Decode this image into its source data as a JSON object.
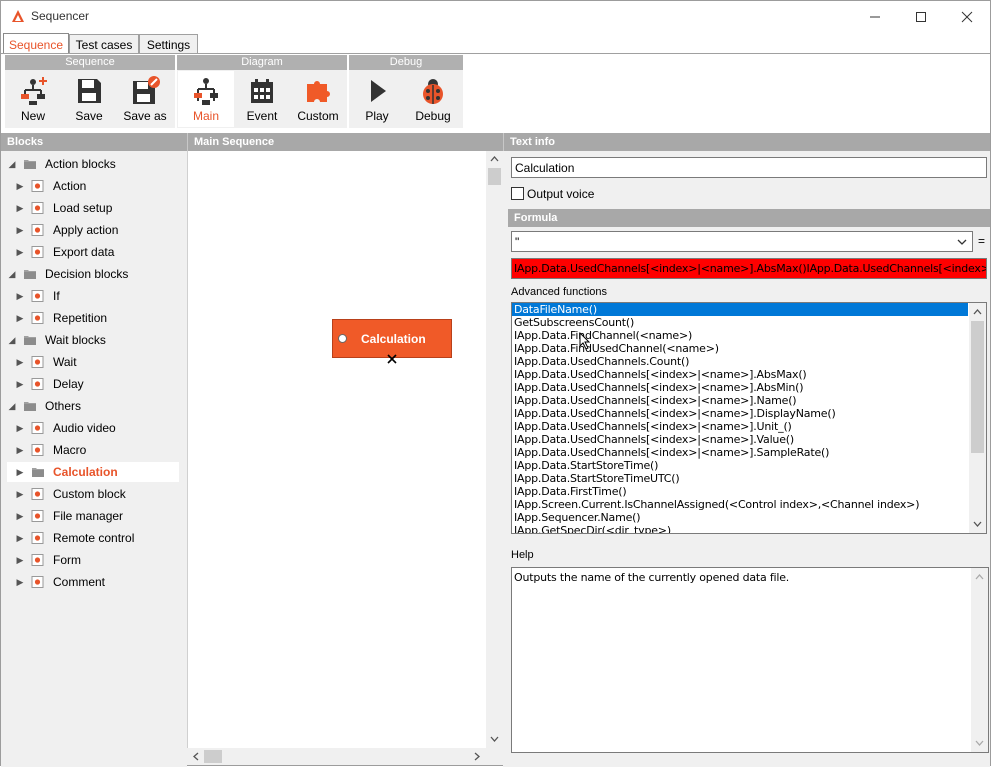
{
  "window": {
    "title": "Sequencer",
    "accent": "#e8542a"
  },
  "tabs": [
    {
      "label": "Sequence"
    },
    {
      "label": "Test cases"
    },
    {
      "label": "Settings"
    }
  ],
  "ribbon": {
    "groups": [
      {
        "title": "Sequence",
        "buttons": [
          {
            "label": "New",
            "icon": "new-block-icon"
          },
          {
            "label": "Save",
            "icon": "floppy-icon"
          },
          {
            "label": "Save as",
            "icon": "floppy-edit-icon"
          }
        ]
      },
      {
        "title": "Diagram",
        "buttons": [
          {
            "label": "Main",
            "icon": "diagram-icon"
          },
          {
            "label": "Event",
            "icon": "calendar-icon"
          },
          {
            "label": "Custom",
            "icon": "puzzle-icon"
          }
        ]
      },
      {
        "title": "Debug",
        "buttons": [
          {
            "label": "Play",
            "icon": "play-icon"
          },
          {
            "label": "Debug",
            "icon": "ladybug-icon"
          }
        ]
      }
    ]
  },
  "blocks": {
    "header": "Blocks",
    "items": [
      {
        "label": "Action blocks",
        "type": "folder"
      },
      {
        "label": "Action",
        "type": "block"
      },
      {
        "label": "Load setup",
        "type": "block"
      },
      {
        "label": "Apply action",
        "type": "block"
      },
      {
        "label": "Export data",
        "type": "block"
      },
      {
        "label": "Decision blocks",
        "type": "folder"
      },
      {
        "label": "If",
        "type": "block"
      },
      {
        "label": "Repetition",
        "type": "block"
      },
      {
        "label": "Wait blocks",
        "type": "folder"
      },
      {
        "label": "Wait",
        "type": "block"
      },
      {
        "label": "Delay",
        "type": "block"
      },
      {
        "label": "Others",
        "type": "folder"
      },
      {
        "label": "Audio video",
        "type": "block"
      },
      {
        "label": "Macro",
        "type": "block"
      },
      {
        "label": "Calculation",
        "type": "folder",
        "selected": true
      },
      {
        "label": "Custom block",
        "type": "block"
      },
      {
        "label": "File manager",
        "type": "block"
      },
      {
        "label": "Remote control",
        "type": "block"
      },
      {
        "label": "Form",
        "type": "block"
      },
      {
        "label": "Comment",
        "type": "block"
      }
    ]
  },
  "main": {
    "header": "Main Sequence",
    "node_label": "Calculation"
  },
  "textinfo": {
    "header": "Text info",
    "name_value": "Calculation",
    "output_voice_label": "Output voice",
    "formula_header": "Formula",
    "formula_select": "\"",
    "equals": "=",
    "formula_value": "IApp.Data.UsedChannels[<index>|<name>].AbsMax()IApp.Data.UsedChannels[<index>|<name>].AbsMin()",
    "advanced_label": "Advanced functions",
    "functions": [
      "DataFileName()",
      "GetSubscreensCount()",
      "IApp.Data.FindChannel(<name>)",
      "IApp.Data.FindUsedChannel(<name>)",
      "IApp.Data.UsedChannels.Count()",
      "IApp.Data.UsedChannels[<index>|<name>].AbsMax()",
      "IApp.Data.UsedChannels[<index>|<name>].AbsMin()",
      "IApp.Data.UsedChannels[<index>|<name>].Name()",
      "IApp.Data.UsedChannels[<index>|<name>].DisplayName()",
      "IApp.Data.UsedChannels[<index>|<name>].Unit_()",
      "IApp.Data.UsedChannels[<index>|<name>].Value()",
      "IApp.Data.UsedChannels[<index>|<name>].SampleRate()",
      "IApp.Data.StartStoreTime()",
      "IApp.Data.StartStoreTimeUTC()",
      "IApp.Data.FirstTime()",
      "IApp.Screen.Current.IsChannelAssigned(<Control index>,<Channel index>)",
      "IApp.Sequencer.Name()",
      "IApp.GetSpecDir(<dir_type>)"
    ],
    "help_label": "Help",
    "help_text": "Outputs the name of the currently opened data file."
  }
}
